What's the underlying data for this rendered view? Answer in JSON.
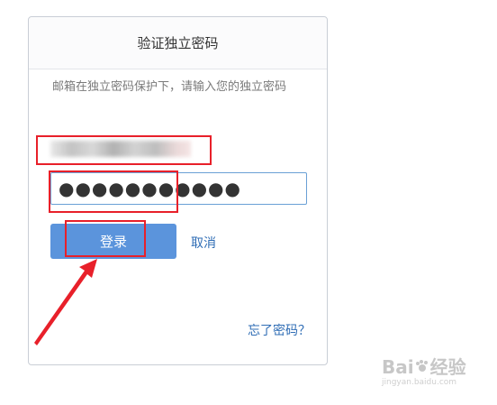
{
  "dialog": {
    "title": "验证独立密码",
    "description": "邮箱在独立密码保护下，请输入您的独立密码",
    "password_value": "●●●●●●●●●●●",
    "login_label": "登录",
    "cancel_label": "取消",
    "forgot_label": "忘了密码？"
  },
  "watermark": {
    "brand_left": "Bai",
    "brand_right": "经验",
    "paw_icon": "paw-icon",
    "domain": "jingyan.baidu.com"
  },
  "colors": {
    "primary_button": "#5b94dc",
    "link": "#2f6db5",
    "annotation_red": "#e8202a",
    "input_border": "#6aa0d6"
  }
}
